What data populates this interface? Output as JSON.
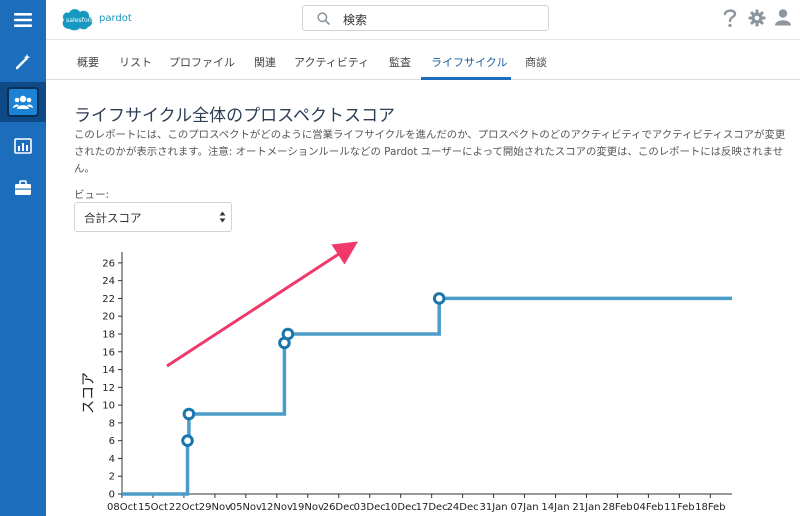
{
  "header": {
    "brand_badge": "salesforce",
    "brand_name": "pardot",
    "search_placeholder": "検索"
  },
  "colors": {
    "sidebar": "#1c6ebc",
    "line": "#4b9cc8",
    "point_stroke": "#1b76ad",
    "arrow": "#f0386b"
  },
  "sidebar": {
    "items": [
      {
        "icon": "menu-icon"
      },
      {
        "icon": "magic-wand-icon"
      },
      {
        "icon": "people-icon",
        "active": true
      },
      {
        "icon": "report-chart-icon"
      },
      {
        "icon": "briefcase-icon"
      }
    ]
  },
  "tabs": [
    {
      "label": "概要"
    },
    {
      "label": "リスト"
    },
    {
      "label": "プロファイル"
    },
    {
      "label": "関連"
    },
    {
      "label": "アクティビティ"
    },
    {
      "label": "監査"
    },
    {
      "label": "ライフサイクル",
      "active": true
    },
    {
      "label": "商談"
    }
  ],
  "page": {
    "title": "ライフサイクル全体のプロスペクトスコア",
    "description": "このレポートには、このプロスペクトがどのように営業ライフサイクルを進んだのか、プロスペクトのどのアクティビティでアクティビティスコアが変更されたのかが表示されます。注意: オートメーションルールなどの Pardot ユーザーによって開始されたスコアの変更は、このレポートには反映されません。",
    "view_label": "ビュー:",
    "view_value": "合計スコア"
  },
  "chart_data": {
    "type": "line",
    "step": true,
    "ylabel": "スコア",
    "ylim": [
      0,
      27
    ],
    "yticks": [
      0,
      2,
      4,
      6,
      8,
      10,
      12,
      14,
      16,
      18,
      20,
      22,
      24,
      26
    ],
    "xticks": [
      "08Oct",
      "15Oct",
      "22Oct",
      "29Nov",
      "05Nov",
      "12Nov",
      "19Nov",
      "26Dec",
      "03Dec",
      "10Dec",
      "17Dec",
      "24Dec",
      "31Jan",
      "07Jan",
      "14Jan",
      "21Jan",
      "28Feb",
      "04Feb",
      "11Feb",
      "18Feb"
    ],
    "series": [
      {
        "x": [
          0,
          9.4,
          9.4,
          9.6,
          9.6,
          23.3,
          23.3,
          23.8,
          23.8,
          45.5,
          45.5,
          87.5
        ],
        "y": [
          0,
          0,
          6,
          6,
          9,
          9,
          17,
          17,
          18,
          18,
          22,
          22
        ],
        "points": [
          [
            9.4,
            6
          ],
          [
            9.6,
            9
          ],
          [
            23.3,
            17
          ],
          [
            23.8,
            18
          ],
          [
            45.5,
            22
          ]
        ]
      }
    ]
  }
}
